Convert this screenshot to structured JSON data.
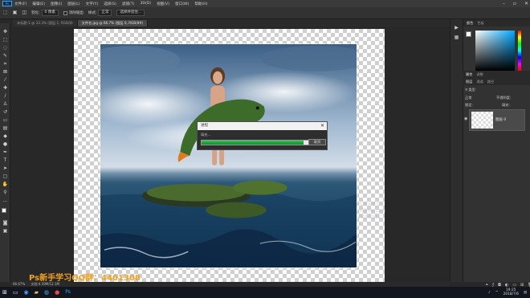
{
  "app": {
    "logo": "Ps"
  },
  "menu": [
    "文件(F)",
    "编辑(E)",
    "图像(I)",
    "图层(L)",
    "文字(Y)",
    "选择(S)",
    "滤镜(T)",
    "3D(D)",
    "视图(V)",
    "窗口(W)",
    "帮助(H)"
  ],
  "window_controls": [
    "minimize-icon",
    "maximize-icon",
    "close-icon"
  ],
  "options": {
    "feather_label": "羽化:",
    "feather_value": "0 像素",
    "antialias_label": "消除锯齿",
    "style_label": "样式:",
    "style_value": "正常",
    "select_mask": "选择并遮住..."
  },
  "tabs": [
    {
      "label": "未标题-1 @ 33.3% (图层 1, RGB/8)",
      "active": false
    },
    {
      "label": "文件名.jpg @ 66.7% (图层 0, RGB/8#)",
      "active": true
    }
  ],
  "dialog": {
    "title": "进程",
    "message": "填充...",
    "progress": 0.95,
    "cancel_label": "取消"
  },
  "watermark": "Ps新手学习QQ群：4401308",
  "faint_text": [
    "PS 新手学习",
    "QQ群4401308",
    "440316925"
  ],
  "panels": {
    "color_tabs": [
      "颜色",
      "色板"
    ],
    "props_tabs": [
      "属性",
      "调整"
    ],
    "layers_tabs": [
      "图层",
      "通道",
      "路径"
    ],
    "layer_kind": "类型",
    "blend_mode": "正常",
    "opacity_label": "不透明度:",
    "fill_label": "填充:",
    "lock_label": "锁定:",
    "layer_name": "图层 0"
  },
  "status": {
    "zoom": "66.67%",
    "doc": "文档:4.59M/12.1M"
  },
  "colors": {
    "accent": "#31a8ff",
    "progress": "#1fa33d",
    "watermark": "#f0a020"
  },
  "taskbar": {
    "time": "19:25",
    "date": "2018/7/6"
  }
}
